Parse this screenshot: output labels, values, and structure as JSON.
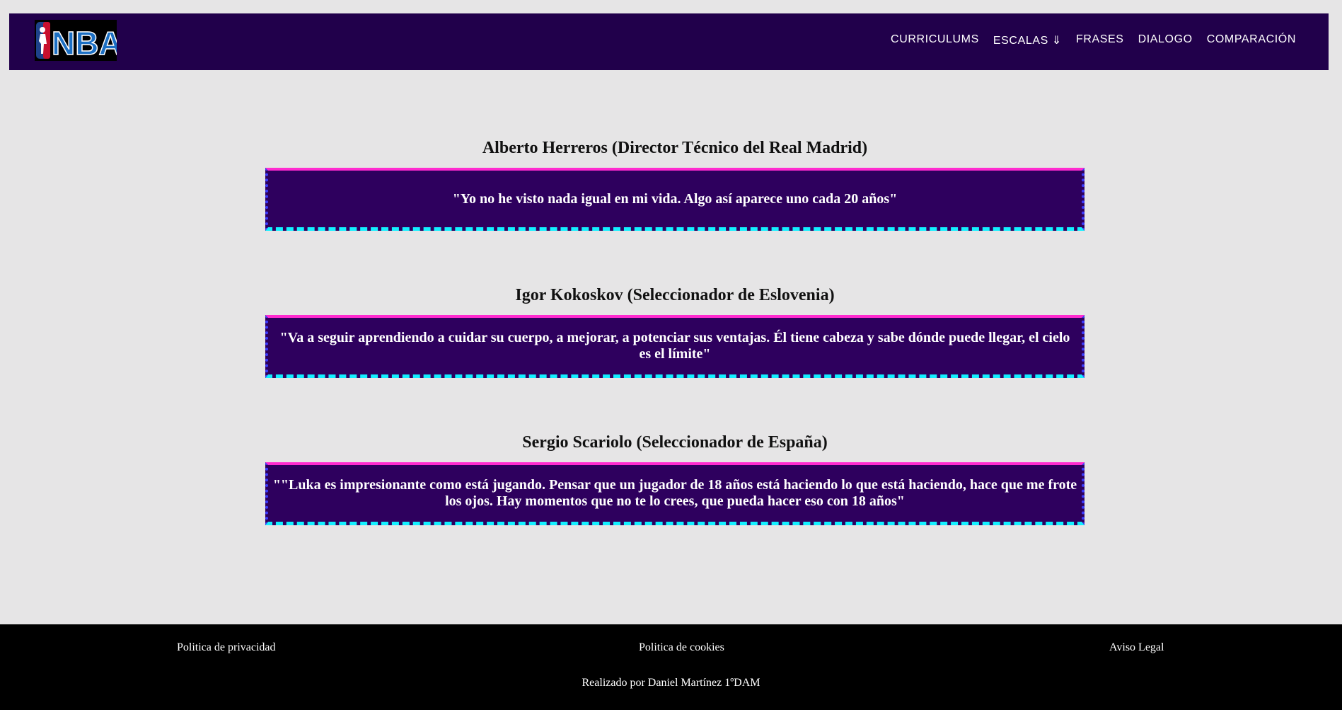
{
  "header": {
    "logo_text": "NBA",
    "nav": [
      "CURRICULUMS",
      "ESCALAS ⇓",
      "FRASES",
      "DIALOGO",
      "COMPARACIÓN"
    ]
  },
  "quotes": [
    {
      "author": "Alberto Herreros (Director Técnico del Real Madrid)",
      "text": "\"Yo no he visto nada igual en mi vida. Algo así aparece uno cada 20 años\""
    },
    {
      "author": "Igor Kokoskov (Seleccionador de Eslovenia)",
      "text": "\"Va a seguir aprendiendo a cuidar su cuerpo, a mejorar, a potenciar sus ventajas. Él tiene cabeza y sabe dónde puede llegar, el cielo es el límite\""
    },
    {
      "author": "Sergio Scariolo (Seleccionador de España)",
      "text": "\"\"Luka es impresionante como está jugando. Pensar que un jugador de 18 años está haciendo lo que está haciendo, hace que me frote los ojos. Hay momentos que no te lo crees, que pueda hacer eso con 18 años\""
    }
  ],
  "footer": {
    "links": [
      "Politica de privacidad",
      "Politica de cookies",
      "Aviso Legal"
    ],
    "credit": "Realizado por Daniel Martínez 1ºDAM"
  },
  "colors": {
    "header_bg": "#21004b",
    "quote_bg": "#2e005e",
    "quote_top_border": "#ff2bd0",
    "quote_side_border": "#3c3cff",
    "quote_bottom_border": "#13f0ff",
    "page_bg": "#e6e5e6",
    "footer_bg": "#000000"
  }
}
